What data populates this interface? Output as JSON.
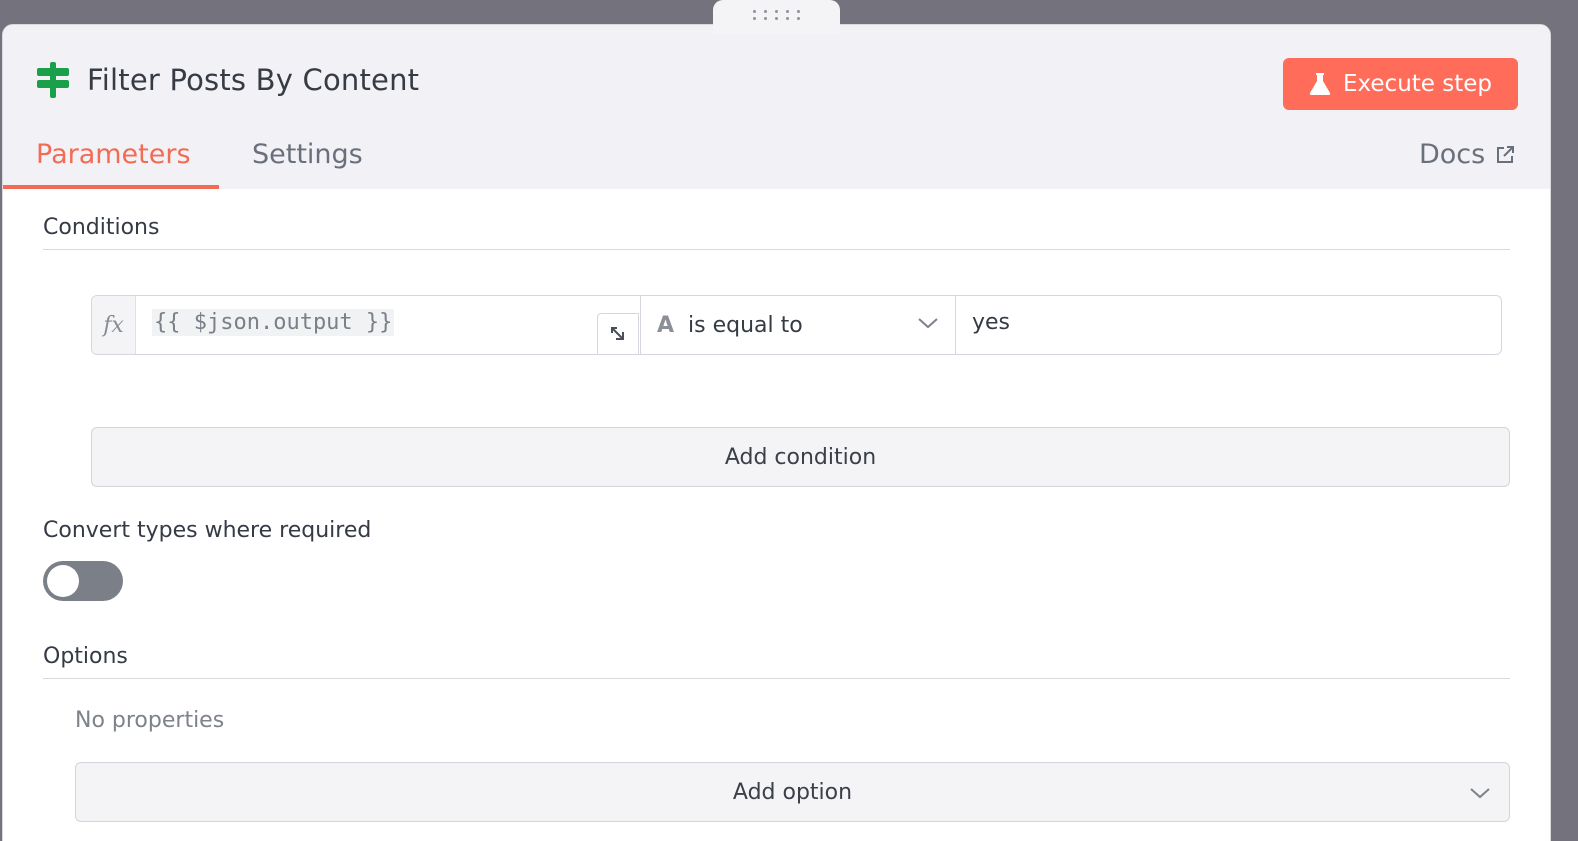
{
  "node": {
    "title": "Filter Posts By Content",
    "icon": "signpost-icon",
    "icon_color": "#1a9f4b"
  },
  "header": {
    "execute_label": "Execute step",
    "execute_icon": "flask-icon",
    "accent_color": "#ff6d5a",
    "tabs": [
      {
        "label": "Parameters",
        "active": true
      },
      {
        "label": "Settings",
        "active": false
      }
    ],
    "docs_label": "Docs"
  },
  "conditions": {
    "section_label": "Conditions",
    "rows": [
      {
        "fx_label": "fx",
        "left_value": "{{ $json.output }}",
        "type_icon": "A",
        "operator": "is equal to",
        "right_value": "yes"
      }
    ],
    "add_label": "Add condition"
  },
  "convert_types": {
    "label": "Convert types where required",
    "enabled": false
  },
  "options": {
    "section_label": "Options",
    "empty_text": "No properties",
    "add_label": "Add option"
  }
}
